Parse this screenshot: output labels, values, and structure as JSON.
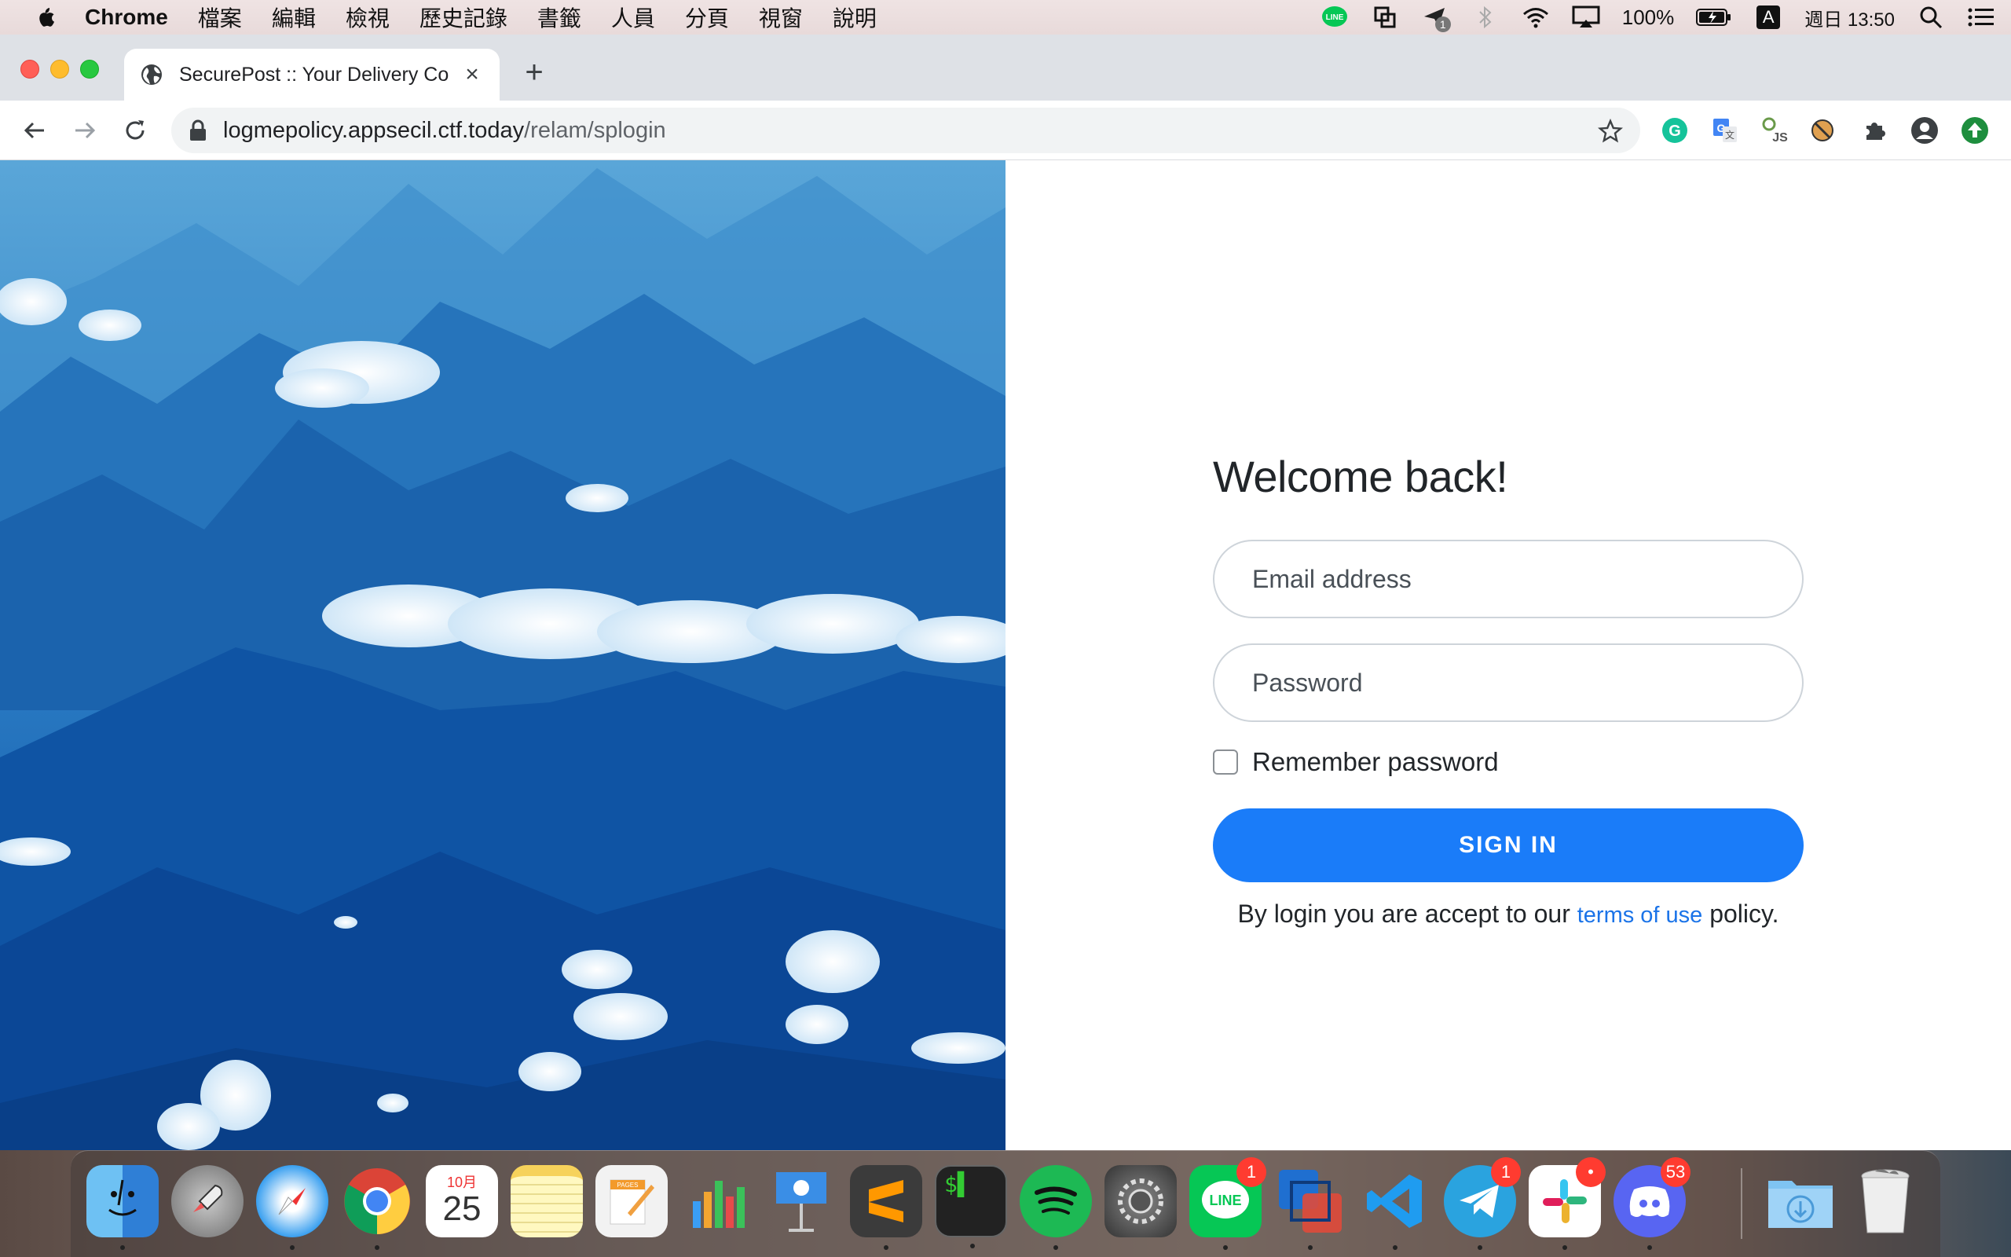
{
  "menubar": {
    "app_name": "Chrome",
    "menus": [
      "檔案",
      "編輯",
      "檢視",
      "歷史記錄",
      "書籤",
      "人員",
      "分頁",
      "視窗",
      "說明"
    ],
    "battery": "100%",
    "input_source": "A",
    "clock": "週日 13:50",
    "status_icons": [
      "line-icon",
      "screen-share-icon",
      "send-icon",
      "bluetooth-icon",
      "wifi-icon",
      "airplay-icon",
      "battery-icon",
      "input-source-icon",
      "spotlight-icon",
      "notification-center-icon"
    ],
    "send_badge": "1"
  },
  "browser": {
    "tab_title": "SecurePost :: Your Delivery Co",
    "url_host": "logmepolicy.appsecil.ctf.today",
    "url_path": "/relam/splogin",
    "extensions": [
      "grammarly-icon",
      "google-translate-icon",
      "js-extension-icon",
      "blocked-extension-icon",
      "puzzle-extensions-icon",
      "profile-icon",
      "update-icon"
    ]
  },
  "login": {
    "heading": "Welcome back!",
    "email_placeholder": "Email address",
    "password_placeholder": "Password",
    "remember_label": "Remember password",
    "remember_checked": false,
    "signin_label": "SIGN IN",
    "terms_prefix": "By login you are accept to our ",
    "terms_link": "terms of use",
    "terms_suffix": " policy."
  },
  "dock": {
    "apps": [
      {
        "name": "finder",
        "badge": "",
        "running": true
      },
      {
        "name": "launchpad",
        "badge": "",
        "running": false
      },
      {
        "name": "safari",
        "badge": "",
        "running": true
      },
      {
        "name": "chrome",
        "badge": "",
        "running": true
      },
      {
        "name": "calendar",
        "badge": "",
        "running": false,
        "month": "10月",
        "day": "25"
      },
      {
        "name": "notes",
        "badge": "",
        "running": false
      },
      {
        "name": "pages",
        "badge": "",
        "running": false,
        "label": "PAGES"
      },
      {
        "name": "numbers",
        "badge": "",
        "running": false
      },
      {
        "name": "keynote",
        "badge": "",
        "running": false
      },
      {
        "name": "sublime-text",
        "badge": "",
        "running": true
      },
      {
        "name": "terminal",
        "badge": "",
        "running": true
      },
      {
        "name": "spotify",
        "badge": "",
        "running": true
      },
      {
        "name": "system-preferences",
        "badge": "",
        "running": false
      },
      {
        "name": "line",
        "badge": "1",
        "running": true,
        "label": "LINE"
      },
      {
        "name": "virtualbox",
        "badge": "",
        "running": true
      },
      {
        "name": "vscode",
        "badge": "",
        "running": true
      },
      {
        "name": "telegram",
        "badge": "1",
        "running": true
      },
      {
        "name": "slack",
        "badge": "•",
        "running": true
      },
      {
        "name": "discord",
        "badge": "53",
        "running": true
      },
      {
        "name": "downloads",
        "badge": "",
        "running": false
      },
      {
        "name": "trash",
        "badge": "",
        "running": false
      }
    ]
  }
}
